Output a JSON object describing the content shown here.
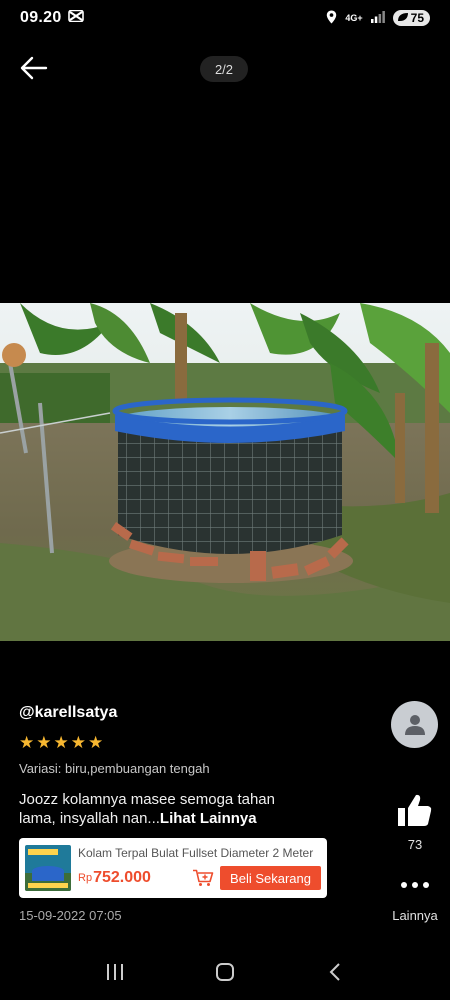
{
  "status_bar": {
    "time": "09.20",
    "network": "4G+",
    "battery": "75"
  },
  "viewer": {
    "page_counter": "2/2"
  },
  "review": {
    "username": "@karellsatya",
    "rating": 5,
    "variant": "Variasi: biru,pembuangan tengah",
    "text": "Joozz kolamnya masee semoga tahan lama, insyallah nan...",
    "see_more": "Lihat Lainnya",
    "date": "15-09-2022 07:05"
  },
  "product": {
    "name": "Kolam Terpal Bulat Fullset Diameter 2 Meter",
    "currency": "Rp",
    "price": "752.000",
    "buy_label": "Beli Sekarang"
  },
  "actions": {
    "like_count": "73",
    "more_label": "Lainnya"
  },
  "colors": {
    "accent": "#ee4d2d",
    "star": "#f7b731",
    "pond_blue": "#2b66c9"
  }
}
